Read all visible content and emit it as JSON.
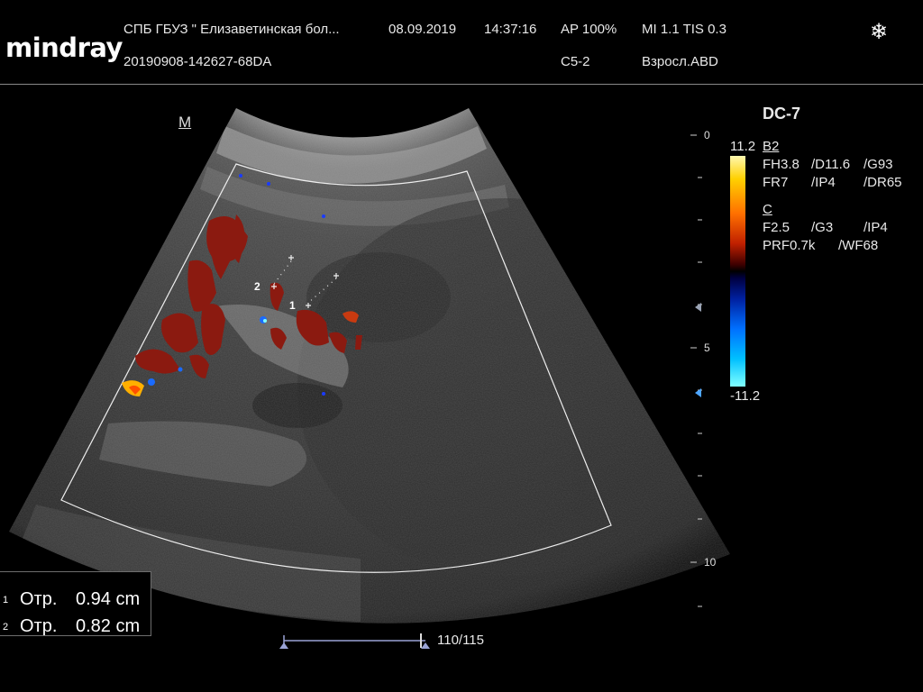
{
  "header": {
    "logo": "mindray",
    "institution": "СПБ  ГБУЗ \" Елизаветинская бол...",
    "date": "08.09.2019",
    "time": "14:37:16",
    "ap": "AP  100%",
    "mi_tis": "MI 1.1 TIS 0.3",
    "exam_id": "20190908-142627-68DA",
    "probe": "C5-2",
    "preset": "Взросл.ABD",
    "freeze_icon": "snowflake-icon"
  },
  "image": {
    "orientation_marker": "M"
  },
  "right_panel": {
    "mode_preset": "DC-7",
    "color_scale_max": "11.2",
    "color_scale_min": "-11.2",
    "b_section": {
      "title": "B2",
      "rows": [
        [
          "FH3.8",
          "/D11.6",
          "/G93"
        ],
        [
          "FR7",
          "/IP4",
          "/DR65"
        ]
      ]
    },
    "c_section": {
      "title": "C",
      "rows": [
        [
          "F2.5",
          "/G3",
          "/IP4"
        ],
        [
          "PRF0.7k",
          "/WF68"
        ]
      ]
    }
  },
  "depth_scale": {
    "labels": [
      "0",
      "5",
      "10"
    ]
  },
  "measurements": [
    {
      "index": "1",
      "name": "Отр.",
      "value": "0.94 cm"
    },
    {
      "index": "2",
      "name": "Отр.",
      "value": "0.82 cm"
    }
  ],
  "cine": {
    "frames": "110/115"
  },
  "caliper_labels": [
    "1",
    "2"
  ],
  "colors": {
    "background": "#000000",
    "text": "#e8e8e8",
    "doppler_red": "#8b1a10",
    "doppler_blue": "#1a6bff",
    "focus_marker": "#4da6ff"
  }
}
